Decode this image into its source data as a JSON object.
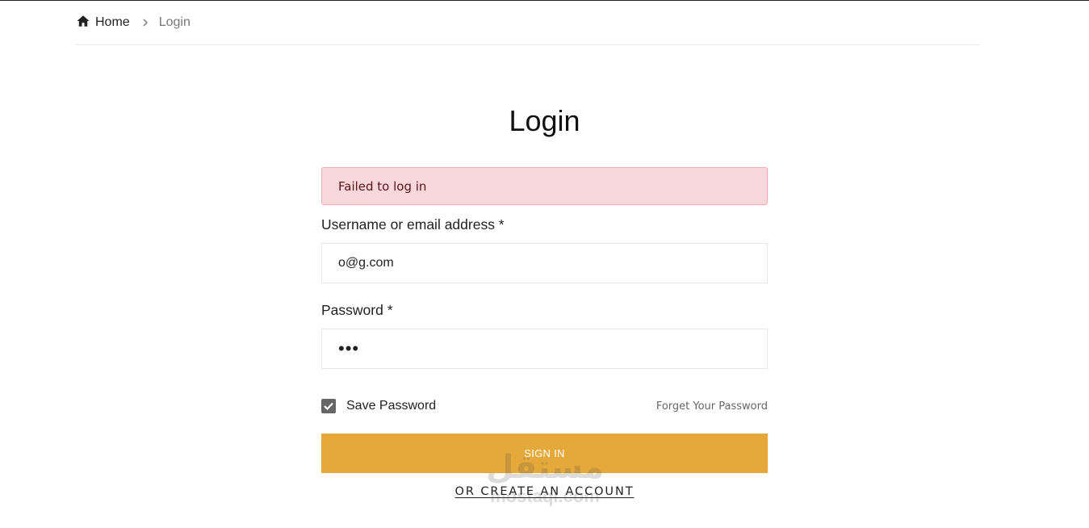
{
  "breadcrumb": {
    "home_label": "Home",
    "home_icon": "home-icon",
    "separator_icon": "chevron-right-icon",
    "current_label": "Login"
  },
  "page": {
    "title": "Login"
  },
  "alert": {
    "message": "Failed to log in",
    "background": "#f8d7da",
    "text_color": "#58151c"
  },
  "form": {
    "username_label": "Username or email address *",
    "username_value": "o@g.com",
    "password_label": "Password *",
    "password_value": "•••",
    "save_password_label": "Save Password",
    "save_password_checked": true,
    "forgot_password_label": "Forget Your Password",
    "sign_in_label": "SIGN IN",
    "create_account_label": "OR CREATE AN ACCOUNT"
  },
  "watermark": {
    "arabic": "مستقل",
    "latin": "mostaqi.com"
  },
  "colors": {
    "accent": "#e5a93b",
    "text": "#222222",
    "muted": "#777777"
  }
}
